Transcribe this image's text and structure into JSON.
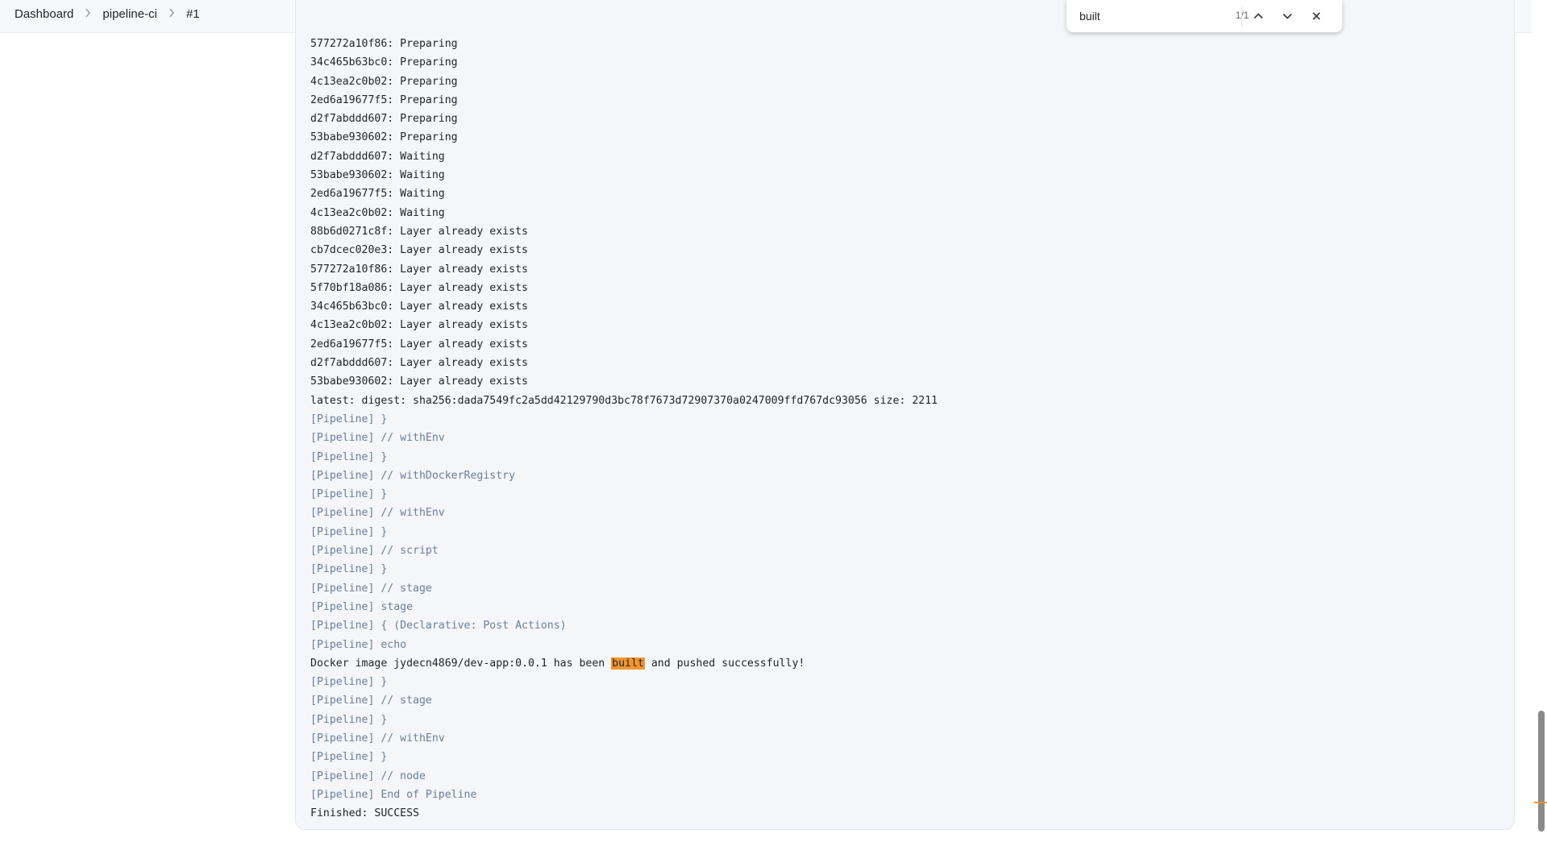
{
  "breadcrumb": {
    "items": [
      "Dashboard",
      "pipeline-ci",
      "#1"
    ],
    "separator_icon": "chevron-right-icon"
  },
  "find_bar": {
    "query": "built",
    "match_count": "1/1",
    "prev_icon": "chevron-up-icon",
    "next_icon": "chevron-down-icon",
    "close_icon": "close-icon"
  },
  "console": {
    "lines": [
      {
        "text": "577272a10f86: Preparing",
        "kind": "output"
      },
      {
        "text": "34c465b63bc0: Preparing",
        "kind": "output"
      },
      {
        "text": "4c13ea2c0b02: Preparing",
        "kind": "output"
      },
      {
        "text": "2ed6a19677f5: Preparing",
        "kind": "output"
      },
      {
        "text": "d2f7abddd607: Preparing",
        "kind": "output"
      },
      {
        "text": "53babe930602: Preparing",
        "kind": "output"
      },
      {
        "text": "d2f7abddd607: Waiting",
        "kind": "output"
      },
      {
        "text": "53babe930602: Waiting",
        "kind": "output"
      },
      {
        "text": "2ed6a19677f5: Waiting",
        "kind": "output"
      },
      {
        "text": "4c13ea2c0b02: Waiting",
        "kind": "output"
      },
      {
        "text": "88b6d0271c8f: Layer already exists",
        "kind": "output"
      },
      {
        "text": "cb7dcec020e3: Layer already exists",
        "kind": "output"
      },
      {
        "text": "577272a10f86: Layer already exists",
        "kind": "output"
      },
      {
        "text": "5f70bf18a086: Layer already exists",
        "kind": "output"
      },
      {
        "text": "34c465b63bc0: Layer already exists",
        "kind": "output"
      },
      {
        "text": "4c13ea2c0b02: Layer already exists",
        "kind": "output"
      },
      {
        "text": "2ed6a19677f5: Layer already exists",
        "kind": "output"
      },
      {
        "text": "d2f7abddd607: Layer already exists",
        "kind": "output"
      },
      {
        "text": "53babe930602: Layer already exists",
        "kind": "output"
      },
      {
        "text": "latest: digest: sha256:dada7549fc2a5dd42129790d3bc78f7673d72907370a0247009ffd767dc93056 size: 2211",
        "kind": "output"
      },
      {
        "text": "[Pipeline] }",
        "kind": "pipeline"
      },
      {
        "text": "[Pipeline] // withEnv",
        "kind": "pipeline"
      },
      {
        "text": "[Pipeline] }",
        "kind": "pipeline"
      },
      {
        "text": "[Pipeline] // withDockerRegistry",
        "kind": "pipeline"
      },
      {
        "text": "[Pipeline] }",
        "kind": "pipeline"
      },
      {
        "text": "[Pipeline] // withEnv",
        "kind": "pipeline"
      },
      {
        "text": "[Pipeline] }",
        "kind": "pipeline"
      },
      {
        "text": "[Pipeline] // script",
        "kind": "pipeline"
      },
      {
        "text": "[Pipeline] }",
        "kind": "pipeline"
      },
      {
        "text": "[Pipeline] // stage",
        "kind": "pipeline"
      },
      {
        "text": "[Pipeline] stage",
        "kind": "pipeline"
      },
      {
        "text": "[Pipeline] { (Declarative: Post Actions)",
        "kind": "pipeline"
      },
      {
        "text": "[Pipeline] echo",
        "kind": "pipeline"
      },
      {
        "text": "Docker image jydecn4869/dev-app:0.0.1 has been built and pushed successfully!",
        "kind": "output",
        "highlight": "built"
      },
      {
        "text": "[Pipeline] }",
        "kind": "pipeline"
      },
      {
        "text": "[Pipeline] // stage",
        "kind": "pipeline"
      },
      {
        "text": "[Pipeline] }",
        "kind": "pipeline"
      },
      {
        "text": "[Pipeline] // withEnv",
        "kind": "pipeline"
      },
      {
        "text": "[Pipeline] }",
        "kind": "pipeline"
      },
      {
        "text": "[Pipeline] // node",
        "kind": "pipeline"
      },
      {
        "text": "[Pipeline] End of Pipeline",
        "kind": "pipeline"
      },
      {
        "text": "Finished: SUCCESS",
        "kind": "output"
      }
    ]
  },
  "colors": {
    "pipeline_text": "#6b7e99",
    "output_text": "#1f2328",
    "highlight": "#f3952e",
    "console_bg": "#f4f6f9"
  }
}
